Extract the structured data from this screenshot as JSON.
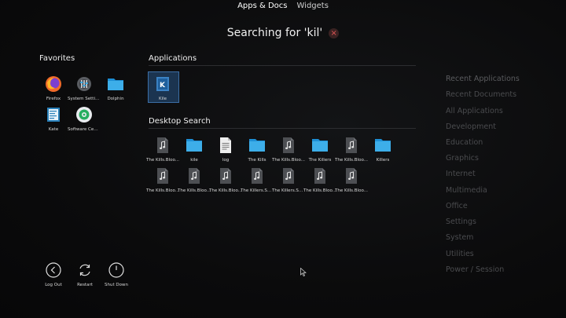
{
  "tabs": [
    {
      "label": "Apps & Docs",
      "active": true
    },
    {
      "label": "Widgets",
      "active": false
    }
  ],
  "search": {
    "title": "Searching for 'kil'",
    "clear_glyph": "×"
  },
  "favorites": {
    "title": "Favorites",
    "items": [
      {
        "label": "Firefox",
        "icon": "firefox-icon"
      },
      {
        "label": "System Settings",
        "icon": "settings-icon"
      },
      {
        "label": "Dolphin",
        "icon": "folder-icon"
      },
      {
        "label": "Kate",
        "icon": "kate-icon"
      },
      {
        "label": "Software Cent...",
        "icon": "discover-icon"
      }
    ]
  },
  "applications": {
    "title": "Applications",
    "items": [
      {
        "label": "Kile",
        "icon": "kile-icon",
        "selected": true
      }
    ]
  },
  "desktop_search": {
    "title": "Desktop Search",
    "items": [
      {
        "label": "The Kills.Bloo...",
        "icon": "audio-file-icon"
      },
      {
        "label": "kile",
        "icon": "folder-icon"
      },
      {
        "label": "log",
        "icon": "text-file-icon"
      },
      {
        "label": "The Kills",
        "icon": "folder-icon"
      },
      {
        "label": "The Kills.Bloo...",
        "icon": "audio-file-icon"
      },
      {
        "label": "The Killers",
        "icon": "folder-icon"
      },
      {
        "label": "The Kills.Bloo...",
        "icon": "audio-file-icon"
      },
      {
        "label": "Killers",
        "icon": "folder-icon"
      },
      {
        "label": "The Kills.Bloo...",
        "icon": "audio-file-icon"
      },
      {
        "label": "The Kills.Bloo...",
        "icon": "audio-file-icon"
      },
      {
        "label": "The Kills.Bloo...",
        "icon": "audio-file-icon"
      },
      {
        "label": "The Killers.Sa...",
        "icon": "audio-file-icon"
      },
      {
        "label": "The Killers.Sa...",
        "icon": "audio-file-icon"
      },
      {
        "label": "The Kills.Bloo...",
        "icon": "audio-file-icon"
      },
      {
        "label": "The Kills.Bloo...",
        "icon": "audio-file-icon"
      }
    ]
  },
  "categories": [
    "Recent Applications",
    "Recent Documents",
    "All Applications",
    "Development",
    "Education",
    "Graphics",
    "Internet",
    "Multimedia",
    "Office",
    "Settings",
    "System",
    "Utilities",
    "Power / Session"
  ],
  "power": [
    {
      "label": "Log Out",
      "icon": "logout-icon"
    },
    {
      "label": "Restart",
      "icon": "restart-icon"
    },
    {
      "label": "Shut Down",
      "icon": "shutdown-icon"
    }
  ],
  "colors": {
    "accent": "#3b6ea5",
    "folder": "#3daee9",
    "background": "#0a0a0b"
  }
}
